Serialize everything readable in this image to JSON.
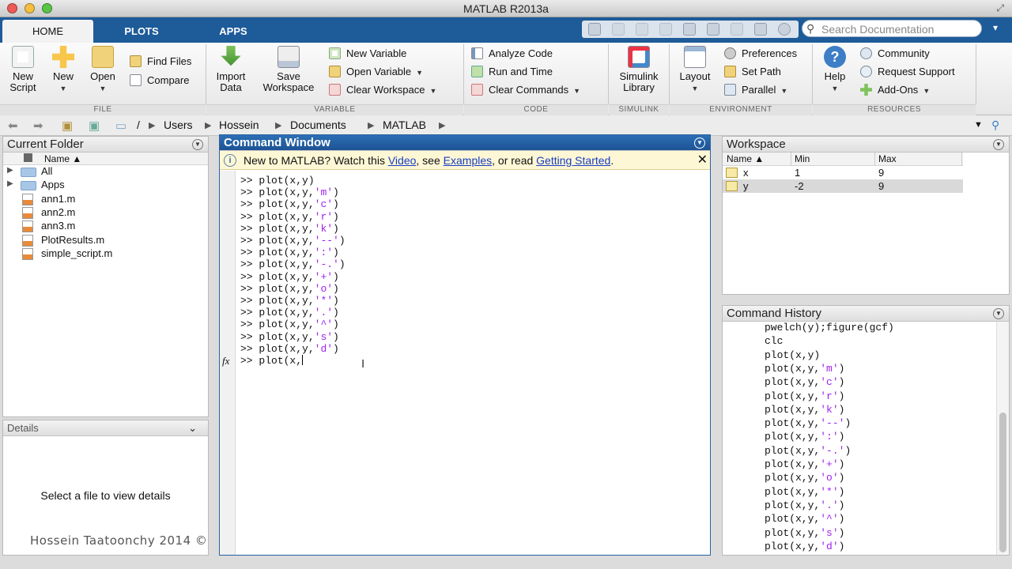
{
  "window": {
    "title": "MATLAB R2013a"
  },
  "tabs": [
    {
      "label": "HOME"
    },
    {
      "label": "PLOTS"
    },
    {
      "label": "APPS"
    }
  ],
  "search": {
    "placeholder": "Search Documentation"
  },
  "ribbon": {
    "file": {
      "group_label": "FILE",
      "new_script": "New\nScript",
      "new": "New",
      "open": "Open",
      "find_files": "Find Files",
      "compare": "Compare"
    },
    "variable": {
      "group_label": "VARIABLE",
      "import_data": "Import\nData",
      "save_workspace": "Save\nWorkspace",
      "new_variable": "New Variable",
      "open_variable": "Open Variable",
      "clear_workspace": "Clear Workspace"
    },
    "code": {
      "group_label": "CODE",
      "analyze_code": "Analyze Code",
      "run_and_time": "Run and Time",
      "clear_commands": "Clear Commands"
    },
    "simulink": {
      "group_label": "SIMULINK",
      "simulink_library": "Simulink\nLibrary"
    },
    "environment": {
      "group_label": "ENVIRONMENT",
      "layout": "Layout",
      "preferences": "Preferences",
      "set_path": "Set Path",
      "parallel": "Parallel"
    },
    "resources": {
      "group_label": "RESOURCES",
      "help": "Help",
      "community": "Community",
      "request_support": "Request Support",
      "add_ons": "Add-Ons"
    }
  },
  "path": {
    "root": "/",
    "segments": [
      "Users",
      "Hossein",
      "Documents",
      "MATLAB"
    ]
  },
  "current_folder": {
    "title": "Current Folder",
    "column_name": "Name ▲",
    "items": [
      {
        "name": "All",
        "type": "folder"
      },
      {
        "name": "Apps",
        "type": "folder"
      },
      {
        "name": "ann1.m",
        "type": "mfile"
      },
      {
        "name": "ann2.m",
        "type": "mfile"
      },
      {
        "name": "ann3.m",
        "type": "mfile"
      },
      {
        "name": "PlotResults.m",
        "type": "mfile"
      },
      {
        "name": "simple_script.m",
        "type": "mfile"
      }
    ]
  },
  "details": {
    "title": "Details",
    "empty_message": "Select a file to view details"
  },
  "watermark": "Hossein Taatoonchy 2014 ©",
  "command_window": {
    "title": "Command Window",
    "info": {
      "prefix": "New to MATLAB? Watch this ",
      "video": "Video",
      "mid1": ", see ",
      "examples": "Examples",
      "mid2": ", or read ",
      "getting_started": "Getting Started",
      "suffix": "."
    },
    "prompt": ">>",
    "lines": [
      {
        "code": "plot(x,y)",
        "str": "",
        "tail": ""
      },
      {
        "code": "plot(x,y,",
        "str": "'m'",
        "tail": ")"
      },
      {
        "code": "plot(x,y,",
        "str": "'c'",
        "tail": ")"
      },
      {
        "code": "plot(x,y,",
        "str": "'r'",
        "tail": ")"
      },
      {
        "code": "plot(x,y,",
        "str": "'k'",
        "tail": ")"
      },
      {
        "code": "plot(x,y,",
        "str": "'--'",
        "tail": ")"
      },
      {
        "code": "plot(x,y,",
        "str": "':'",
        "tail": ")"
      },
      {
        "code": "plot(x,y,",
        "str": "'-.'",
        "tail": ")"
      },
      {
        "code": "plot(x,y,",
        "str": "'+'",
        "tail": ")"
      },
      {
        "code": "plot(x,y,",
        "str": "'o'",
        "tail": ")"
      },
      {
        "code": "plot(x,y,",
        "str": "'*'",
        "tail": ")"
      },
      {
        "code": "plot(x,y,",
        "str": "'.'",
        "tail": ")"
      },
      {
        "code": "plot(x,y,",
        "str": "'^'",
        "tail": ")"
      },
      {
        "code": "plot(x,y,",
        "str": "'s'",
        "tail": ")"
      },
      {
        "code": "plot(x,y,",
        "str": "'d'",
        "tail": ")"
      }
    ],
    "current_input": "plot(x,",
    "fx_label": "fx"
  },
  "workspace": {
    "title": "Workspace",
    "columns": [
      "Name ▲",
      "Min",
      "Max"
    ],
    "rows": [
      {
        "name": "x",
        "min": "1",
        "max": "9"
      },
      {
        "name": "y",
        "min": "-2",
        "max": "9"
      }
    ]
  },
  "command_history": {
    "title": "Command History",
    "lines": [
      {
        "code": "pwelch(y);figure(gcf)",
        "str": "",
        "tail": ""
      },
      {
        "code": "clc",
        "str": "",
        "tail": ""
      },
      {
        "code": "plot(x,y)",
        "str": "",
        "tail": ""
      },
      {
        "code": "plot(x,y,",
        "str": "'m'",
        "tail": ")"
      },
      {
        "code": "plot(x,y,",
        "str": "'c'",
        "tail": ")"
      },
      {
        "code": "plot(x,y,",
        "str": "'r'",
        "tail": ")"
      },
      {
        "code": "plot(x,y,",
        "str": "'k'",
        "tail": ")"
      },
      {
        "code": "plot(x,y,",
        "str": "'--'",
        "tail": ")"
      },
      {
        "code": "plot(x,y,",
        "str": "':'",
        "tail": ")"
      },
      {
        "code": "plot(x,y,",
        "str": "'-.'",
        "tail": ")"
      },
      {
        "code": "plot(x,y,",
        "str": "'+'",
        "tail": ")"
      },
      {
        "code": "plot(x,y,",
        "str": "'o'",
        "tail": ")"
      },
      {
        "code": "plot(x,y,",
        "str": "'*'",
        "tail": ")"
      },
      {
        "code": "plot(x,y,",
        "str": "'.'",
        "tail": ")"
      },
      {
        "code": "plot(x,y,",
        "str": "'^'",
        "tail": ")"
      },
      {
        "code": "plot(x,y,",
        "str": "'s'",
        "tail": ")"
      },
      {
        "code": "plot(x,y,",
        "str": "'d'",
        "tail": ")"
      }
    ]
  },
  "colors": {
    "accent": "#1d5b99",
    "string": "#a020f0",
    "link": "#1a3dc1"
  }
}
